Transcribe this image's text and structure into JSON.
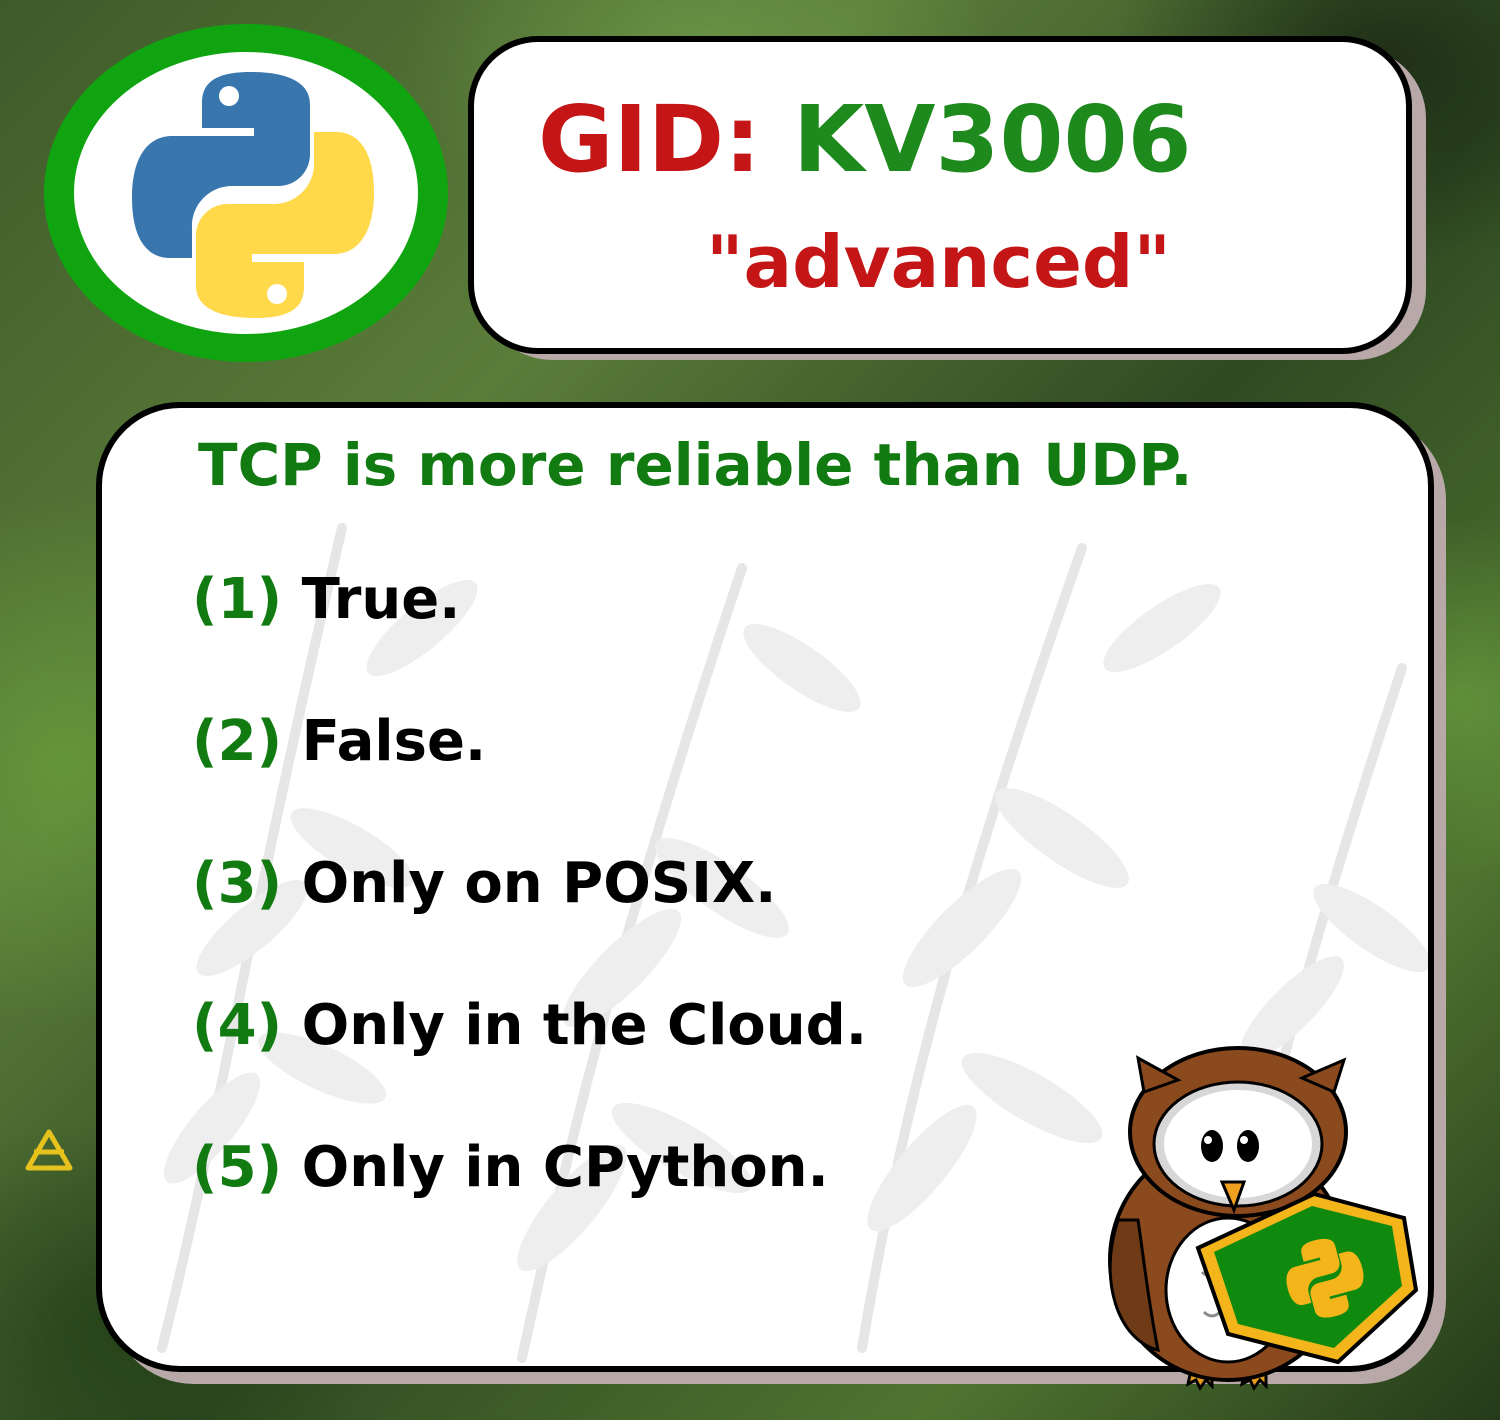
{
  "logo": {
    "icon": "python-logo-icon",
    "ring_color": "#10a410",
    "blue": "#3a76ae",
    "yellow": "#ffd43b"
  },
  "header": {
    "gid_label": "GID:",
    "gid_value": "KV3006",
    "level": "\"advanced\"",
    "label_color": "#c41616",
    "value_color": "#1e8a1e"
  },
  "quiz": {
    "question": "TCP is more reliable than UDP.",
    "options": [
      {
        "number": "(1)",
        "text": "True."
      },
      {
        "number": "(2)",
        "text": "False."
      },
      {
        "number": "(3)",
        "text": "Only on POSIX."
      },
      {
        "number": "(4)",
        "text": "Only in the Cloud."
      },
      {
        "number": "(5)",
        "text": "Only in CPython."
      }
    ],
    "accent_color": "#117a11"
  },
  "decor": {
    "side_glyph_icon": "triangle-glyph-icon",
    "mascot_icon": "owl-mascot-icon",
    "badge_icon": "python-badge-icon"
  }
}
